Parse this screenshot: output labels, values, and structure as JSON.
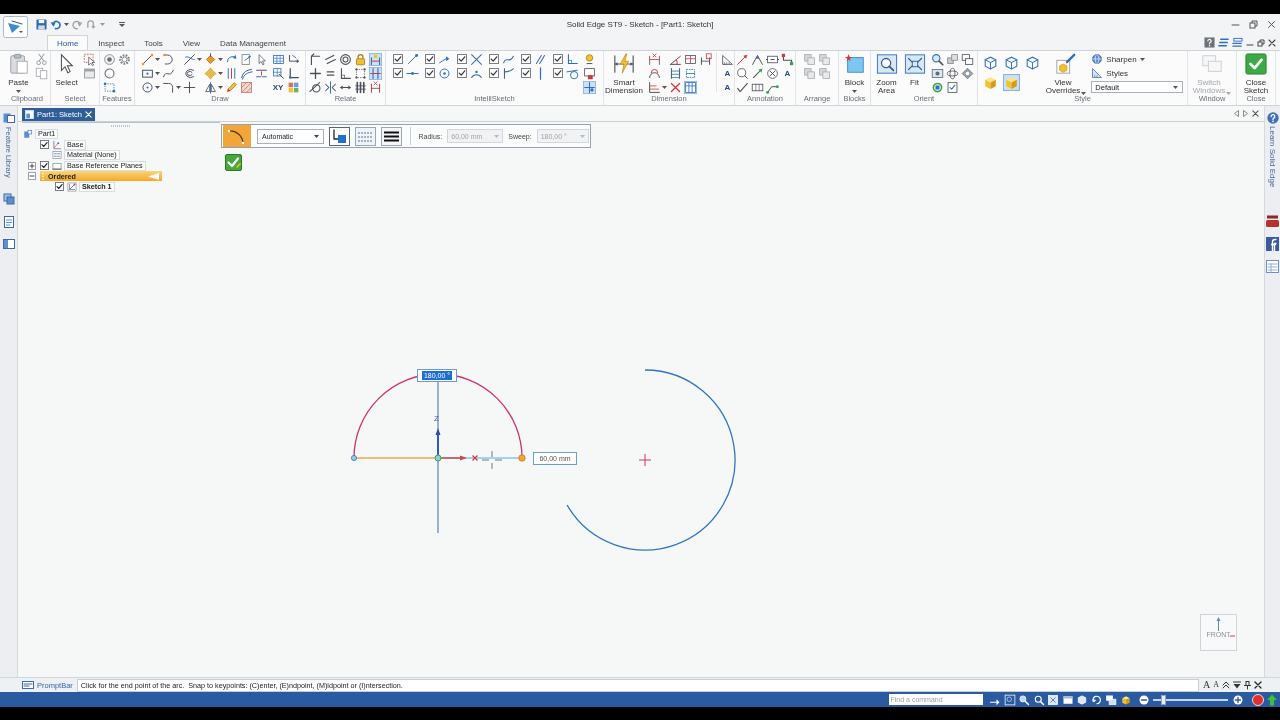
{
  "title_bar": {
    "title": "Solid Edge ST9 - Sketch - [Part1: Sketch]"
  },
  "ribbon_tabs": [
    {
      "label": "Home",
      "selected": true
    },
    {
      "label": "Inspect",
      "selected": false
    },
    {
      "label": "Tools",
      "selected": false
    },
    {
      "label": "View",
      "selected": false
    },
    {
      "label": "Data Management",
      "selected": false
    }
  ],
  "ribbon_groups": [
    {
      "label": "Clipboard",
      "buttons": [
        {
          "label": "Paste",
          "dropdown": true,
          "disabled": false
        }
      ],
      "tools": [
        {
          "on": false
        },
        {
          "on": false
        }
      ]
    },
    {
      "label": "Select",
      "buttons": [
        {
          "label": "Select",
          "dropdown": false,
          "disabled": false
        }
      ],
      "tools": [
        {
          "on": false
        },
        {
          "on": false
        }
      ]
    },
    {
      "label": "Features",
      "tools": [
        {
          "on": false
        },
        {
          "on": false
        },
        {
          "on": false
        },
        {
          "on": false
        }
      ]
    },
    {
      "label": "Draw",
      "tools": [
        {
          "on": false,
          "dropdown": true
        },
        {
          "on": false,
          "dropdown": true
        },
        {
          "on": false,
          "dropdown": true
        },
        {
          "on": false
        },
        {
          "on": false
        },
        {
          "on": false,
          "dropdown": true
        },
        {
          "on": false,
          "dropdown": true
        },
        {
          "on": false
        },
        {
          "on": false
        },
        {
          "on": false,
          "dropdown": true
        },
        {
          "on": false,
          "dropdown": true
        },
        {
          "on": false,
          "dropdown": true
        },
        {
          "on": false
        },
        {
          "on": false
        },
        {
          "on": false
        },
        {
          "on": false
        },
        {
          "on": false
        },
        {
          "on": false
        },
        {
          "on": false
        },
        {
          "on": false
        },
        {
          "on": false
        },
        {
          "on": false
        },
        {
          "on": false,
          "text": "XY"
        },
        {
          "on": false
        },
        {
          "on": false
        },
        {
          "on": false
        }
      ]
    },
    {
      "label": "Relate",
      "tools": [
        {
          "on": false
        },
        {
          "on": false
        },
        {
          "on": false
        },
        {
          "on": false
        },
        {
          "on": false
        },
        {
          "on": false
        },
        {
          "on": false
        },
        {
          "on": false
        },
        {
          "on": false
        },
        {
          "on": false
        },
        {
          "on": false
        },
        {
          "on": false
        },
        {
          "on": true
        },
        {
          "on": true
        },
        {
          "on": false
        }
      ]
    },
    {
      "label": "IntelliSketch",
      "checks": [
        {
          "checked": true
        },
        {
          "checked": true
        },
        {
          "checked": true
        },
        {
          "checked": true
        },
        {
          "checked": true
        },
        {
          "checked": true
        },
        {
          "checked": true
        },
        {
          "checked": true
        },
        {
          "checked": true
        },
        {
          "checked": true
        },
        {
          "checked": true
        },
        {
          "checked": true
        }
      ],
      "tools": [
        {
          "on": false
        },
        {
          "on": false
        },
        {
          "on": true
        }
      ]
    },
    {
      "label": "Dimension",
      "buttons": [
        {
          "label": "Smart Dimension",
          "dropdown": false,
          "disabled": false
        }
      ],
      "tools": [
        {
          "on": false
        },
        {
          "on": false
        },
        {
          "on": false,
          "dropdown": true
        },
        {
          "on": false
        },
        {
          "on": false
        },
        {
          "on": false
        },
        {
          "on": false
        },
        {
          "on": false
        },
        {
          "on": true
        },
        {
          "on": false
        },
        {
          "on": false
        },
        {
          "on": false,
          "text": "A"
        },
        {
          "on": false,
          "text": "A"
        }
      ]
    },
    {
      "label": "Annotation",
      "tools": [
        {
          "on": false
        },
        {
          "on": false
        },
        {
          "on": false
        },
        {
          "on": false
        },
        {
          "on": false
        },
        {
          "on": false
        },
        {
          "on": false
        },
        {
          "on": false
        },
        {
          "on": false
        },
        {
          "on": false
        },
        {
          "on": false,
          "text": "A"
        }
      ]
    },
    {
      "label": "Arrange",
      "tools": [
        {
          "on": false
        },
        {
          "on": false
        },
        {
          "on": false
        },
        {
          "on": false
        }
      ]
    },
    {
      "label": "Blocks",
      "buttons": [
        {
          "label": "Block",
          "dropdown": true,
          "disabled": false
        }
      ]
    },
    {
      "label": "Orient",
      "buttons": [
        {
          "label": "Zoom Area",
          "dropdown": false,
          "disabled": false
        },
        {
          "label": "Fit",
          "dropdown": false,
          "disabled": false
        }
      ],
      "tools": [
        {
          "on": false
        },
        {
          "on": false
        },
        {
          "on": false
        },
        {
          "on": false
        },
        {
          "on": false
        },
        {
          "on": false
        },
        {
          "on": false
        },
        {
          "on": false
        }
      ]
    },
    {
      "label": "Style",
      "tools": [
        {
          "on": false
        },
        {
          "on": false
        },
        {
          "on": false
        },
        {
          "on": true
        },
        {
          "on": false
        }
      ],
      "buttons": [
        {
          "label": "View Overrides",
          "dropdown": true,
          "disabled": false
        }
      ],
      "options": [
        {
          "label": "Sharpen",
          "dropdown": true
        },
        {
          "label": "Styles",
          "dropdown": false
        }
      ],
      "select": {
        "value": "Default"
      }
    },
    {
      "label": "Window",
      "buttons": [
        {
          "label": "Switch Windows",
          "dropdown": true,
          "disabled": true
        }
      ]
    },
    {
      "label": "Close",
      "buttons": [
        {
          "label": "Close Sketch",
          "dropdown": false,
          "disabled": false
        }
      ]
    }
  ],
  "document_tab": {
    "label": "Part1: Sketch"
  },
  "left_sidebar": {
    "label": "Feature Library"
  },
  "pathfinder": {
    "tree": [
      {
        "label": "Part1",
        "kind": "part",
        "children": [
          {
            "label": "Base",
            "kind": "coordinate_system",
            "checked": true
          },
          {
            "label": "Material (None)",
            "kind": "material"
          },
          {
            "label": "Base Reference Planes",
            "kind": "planes",
            "checked": true,
            "expanded": false
          },
          {
            "label": "Ordered",
            "kind": "group",
            "expanded": true,
            "active": true,
            "children": [
              {
                "label": "Sketch 1",
                "kind": "sketch",
                "checked": true,
                "active": true
              }
            ]
          }
        ]
      }
    ]
  },
  "command_bar": {
    "mode": {
      "value": "Automatic"
    },
    "fields": [
      {
        "label": "Radius:",
        "value": "60,00 mm",
        "disabled": true
      },
      {
        "label": "Sweep:",
        "value": "180,00 °",
        "disabled": true
      }
    ]
  },
  "sketch": {
    "axis_label": "Z",
    "readouts": [
      {
        "kind": "sweep",
        "value": "180,00 °",
        "selected": true
      },
      {
        "kind": "radius",
        "value": "60,00 mm",
        "selected": false
      }
    ]
  },
  "view_cube": {
    "label": "FRONT"
  },
  "right_sidebar": {
    "label": "Learn Solid Edge"
  },
  "prompt_bar": {
    "label": "PromptBar",
    "message": "Click for the end point of the arc.  Snap to keypoints: (C)enter, (E)ndpoint, (M)idpoint or (I)ntersection.",
    "font_buttons": [
      "A",
      "A"
    ]
  },
  "status_bar": {
    "search": {
      "placeholder": "Find a command"
    },
    "zoom_slider": {
      "level": 0.13
    }
  }
}
